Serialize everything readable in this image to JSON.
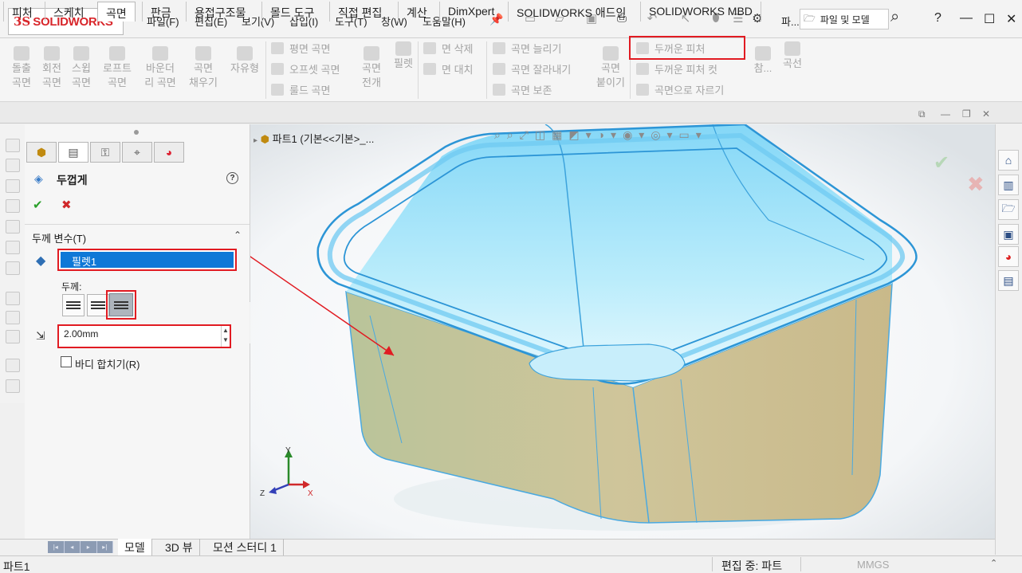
{
  "app": {
    "logo_ds": "3S",
    "logo_text": "SOLIDWORKS"
  },
  "menu": {
    "items": [
      "파일(F)",
      "편집(E)",
      "보기(V)",
      "삽입(I)",
      "도구(T)",
      "창(W)",
      "도움말(H)"
    ],
    "toolbar_file_label": "파...",
    "search_placeholder": "파일 및 모델",
    "help_label": "?"
  },
  "ribbon": {
    "extrude": [
      "돌출",
      "곡면"
    ],
    "revolve": [
      "회전",
      "곡면"
    ],
    "sweep": [
      "스윕",
      "곡면"
    ],
    "loft": [
      "로프트",
      "곡면"
    ],
    "boundary": [
      "바운더",
      "리 곡면"
    ],
    "fill": [
      "곡면",
      "채우기"
    ],
    "freeform": "자유형",
    "planar": "평면 곡면",
    "offset": "오프셋 곡면",
    "ruled": "룰드 곡면",
    "flatten": [
      "곡면",
      "전개"
    ],
    "fillet": "필렛",
    "delete_face": "면 삭제",
    "replace_face": "면 대치",
    "extend": "곡면 늘리기",
    "trim": "곡면 잘라내기",
    "untrim": "곡면 보존",
    "knit": [
      "곡면",
      "붙이기"
    ],
    "thicken": "두꺼운 피처",
    "thicken_cut": "두꺼운 피처 컷",
    "cut_with_surface": "곡면으로 자르기",
    "reference": "참...",
    "curves": "곡선"
  },
  "tabs": [
    "피처",
    "스케치",
    "곡면",
    "판금",
    "용접구조물",
    "몰드 도구",
    "직접 편집",
    "계산",
    "DimXpert",
    "SOLIDWORKS 애드인",
    "SOLIDWORKS MBD"
  ],
  "active_tab": "곡면",
  "property_manager": {
    "title": "두껍게",
    "help": "?",
    "ok": "✔",
    "cancel": "✖",
    "section_label": "두께 변수(T)",
    "selected_face": "필렛1",
    "thickness_label": "두께:",
    "thickness_value": "2.00mm",
    "merge_label": "바디 합치기(R)"
  },
  "graphics": {
    "breadcrumb": "파트1  (기본<<기본>_..."
  },
  "axis": {
    "x": "X",
    "y": "Y",
    "z": "Z"
  },
  "bottom_tabs": [
    "모델",
    "3D 뷰",
    "모션 스터디 1"
  ],
  "status": {
    "left": "파트1",
    "edit": "편집 중: 파트",
    "units": "MMGS"
  },
  "colors": {
    "accent_red": "#e11b22",
    "selection_blue": "#0f78d7",
    "brand_red": "#d8262b",
    "model_blue": "#5fc5ef",
    "model_olive": "#bfbf8a"
  }
}
